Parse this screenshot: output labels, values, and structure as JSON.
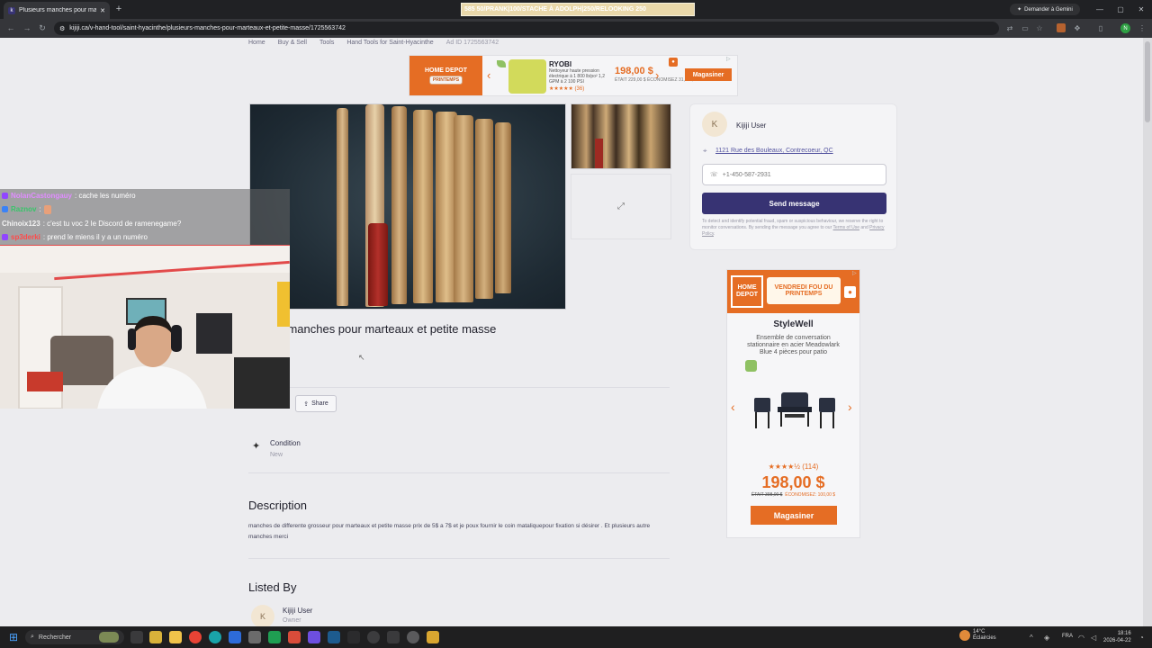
{
  "browser": {
    "tab_title": "Plusieurs manches pour marteau",
    "tab_favicon": "k",
    "stream_banner": "585 50/PRANK|100/STACHE À ADOLPH|250/RELOOKING 250",
    "gemini_label": "Demander à Gemini",
    "url": "kijiji.ca/v-hand-tool/saint-hyacinthe/plusieurs-manches-pour-marteaux-et-petite-masse/1725563742",
    "profile_initial": "N"
  },
  "breadcrumb": [
    "Home",
    "Buy & Sell",
    "Tools",
    "Hand Tools for Saint-Hyacinthe",
    "Ad ID 1725563742"
  ],
  "top_ad": {
    "logo_line1": "HOME DEPOT",
    "logo_line2": "PRINTEMPS",
    "brand": "RYOBI",
    "desc": "Nettoyeur haute pression électrique à 1 800 lb/po² 1,2 GPM à 2 100 PSI",
    "stars": "★★★★★ (36)",
    "price": "198,00 $",
    "old": "ÉTAIT 229,00 $ ÉCONOMISEZ 31,00 $",
    "button": "Magasiner",
    "ad_choice": "▷"
  },
  "seller": {
    "initial": "K",
    "name": "Kijiji User",
    "address": "1121 Rue des Bouleaux, Contrecoeur, QC",
    "phone": "+1-450-587-2931",
    "send_label": "Send message",
    "disclaimer_a": "To detect and identify potential fraud, spam or suspicious behaviour, we reserve the right to monitor conversations. By sending the message you agree to our ",
    "terms_label": "Terms of Use",
    "and_label": " and ",
    "privacy_label": "Privacy Policy",
    "period": "."
  },
  "side_ad": {
    "logo_text": "HOME DEPOT",
    "promo_line1": "VENDREDI FOU DU",
    "promo_line2": "PRINTEMPS",
    "brand": "StyleWell",
    "desc": "Ensemble de conversation stationnaire en acier Meadowlark Blue 4 pièces pour patio",
    "stars": "★★★★½ (114)",
    "price": "198,00 $",
    "was": "ÉTAIT 398,00 $",
    "save": "ÉCONOMISEZ: 100,00 $",
    "button": "Magasiner"
  },
  "listing": {
    "title_visible": "rs manches pour marteaux et petite masse",
    "share_label": "Share",
    "condition_label": "Condition",
    "condition_value": "New",
    "description_heading": "Description",
    "description_text": "manches de differente grosseur pour marteaux et petite masse prix de 5$ a 7$ et je poux fournir le coin mataliquepour fixation si désirer . Et plusieurs autre manches merci",
    "listed_by_heading": "Listed By",
    "lister_initial": "K",
    "lister_name": "Kijiji User",
    "lister_role": "Owner"
  },
  "chat": [
    {
      "user": "NolanCastongauy",
      "msg": ": cache les numéro",
      "color": "#e08cff",
      "badge": "#9146ff"
    },
    {
      "user": "Raznov",
      "msg": ":",
      "color": "#39c46a",
      "badge": "#3b82f6"
    },
    {
      "user": "Chinoix123",
      "msg": ": c'est tu voc 2 le Discord de ramenegame?",
      "color": "#f3f3f3",
      "badge": ""
    },
    {
      "user": "sp3derki",
      "msg": ": prend le miens il y a un numéro",
      "color": "#ff4a4a",
      "badge": "#9146ff"
    }
  ],
  "taskbar": {
    "search_placeholder": "Rechercher",
    "weather_temp": "14°C",
    "weather_desc": "Éclaircies",
    "lang": "FRA",
    "time": "18:16",
    "date": "2026-04-22"
  },
  "colors": {
    "accent": "#373373",
    "home_depot": "#e56d24"
  }
}
